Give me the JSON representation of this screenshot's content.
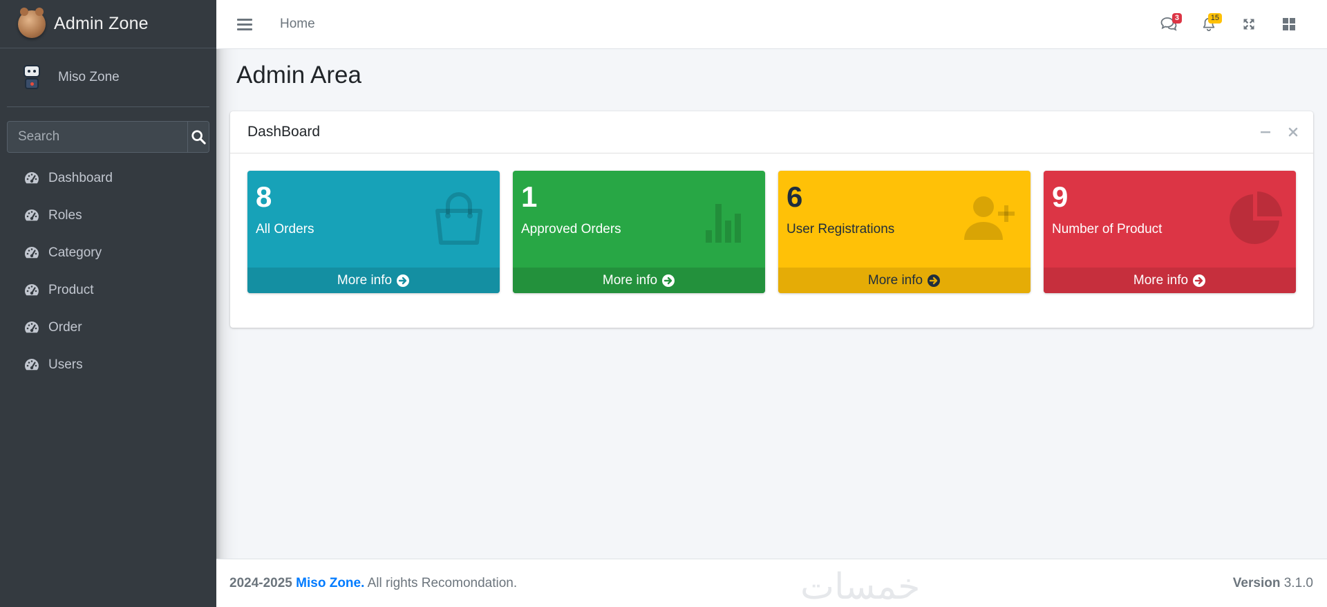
{
  "brand": {
    "title": "Admin Zone",
    "logo_icon": "teddy-bear-logo-icon"
  },
  "user": {
    "name": "Miso Zone",
    "avatar_icon": "robot-avatar-icon"
  },
  "search": {
    "placeholder": "Search",
    "icon": "search-icon"
  },
  "sidebar": {
    "items": [
      {
        "label": "Dashboard",
        "icon": "tachometer-icon"
      },
      {
        "label": "Roles",
        "icon": "tachometer-icon"
      },
      {
        "label": "Category",
        "icon": "tachometer-icon"
      },
      {
        "label": "Product",
        "icon": "tachometer-icon"
      },
      {
        "label": "Order",
        "icon": "tachometer-icon"
      },
      {
        "label": "Users",
        "icon": "tachometer-icon"
      }
    ]
  },
  "header": {
    "home_label": "Home",
    "messages_badge": "3",
    "notifications_badge": "15"
  },
  "page": {
    "title": "Admin Area"
  },
  "card": {
    "title": "DashBoard",
    "boxes": [
      {
        "count": "8",
        "label": "All Orders",
        "footer": "More info",
        "icon": "shopping-bag-icon",
        "color": "#17a2b8"
      },
      {
        "count": "1",
        "label": "Approved Orders",
        "footer": "More info",
        "icon": "bar-chart-icon",
        "color": "#28a745"
      },
      {
        "count": "6",
        "label": "User Registrations",
        "footer": "More info",
        "icon": "user-plus-icon",
        "color": "#ffc107"
      },
      {
        "count": "9",
        "label": "Number of Product",
        "footer": "More info",
        "icon": "pie-chart-icon",
        "color": "#dc3545"
      }
    ]
  },
  "footer": {
    "years": "2024-2025",
    "brand": "Miso Zone.",
    "rights": "All rights Recomondation.",
    "watermark": "خمسات",
    "version_label": "Version",
    "version_value": "3.1.0"
  }
}
